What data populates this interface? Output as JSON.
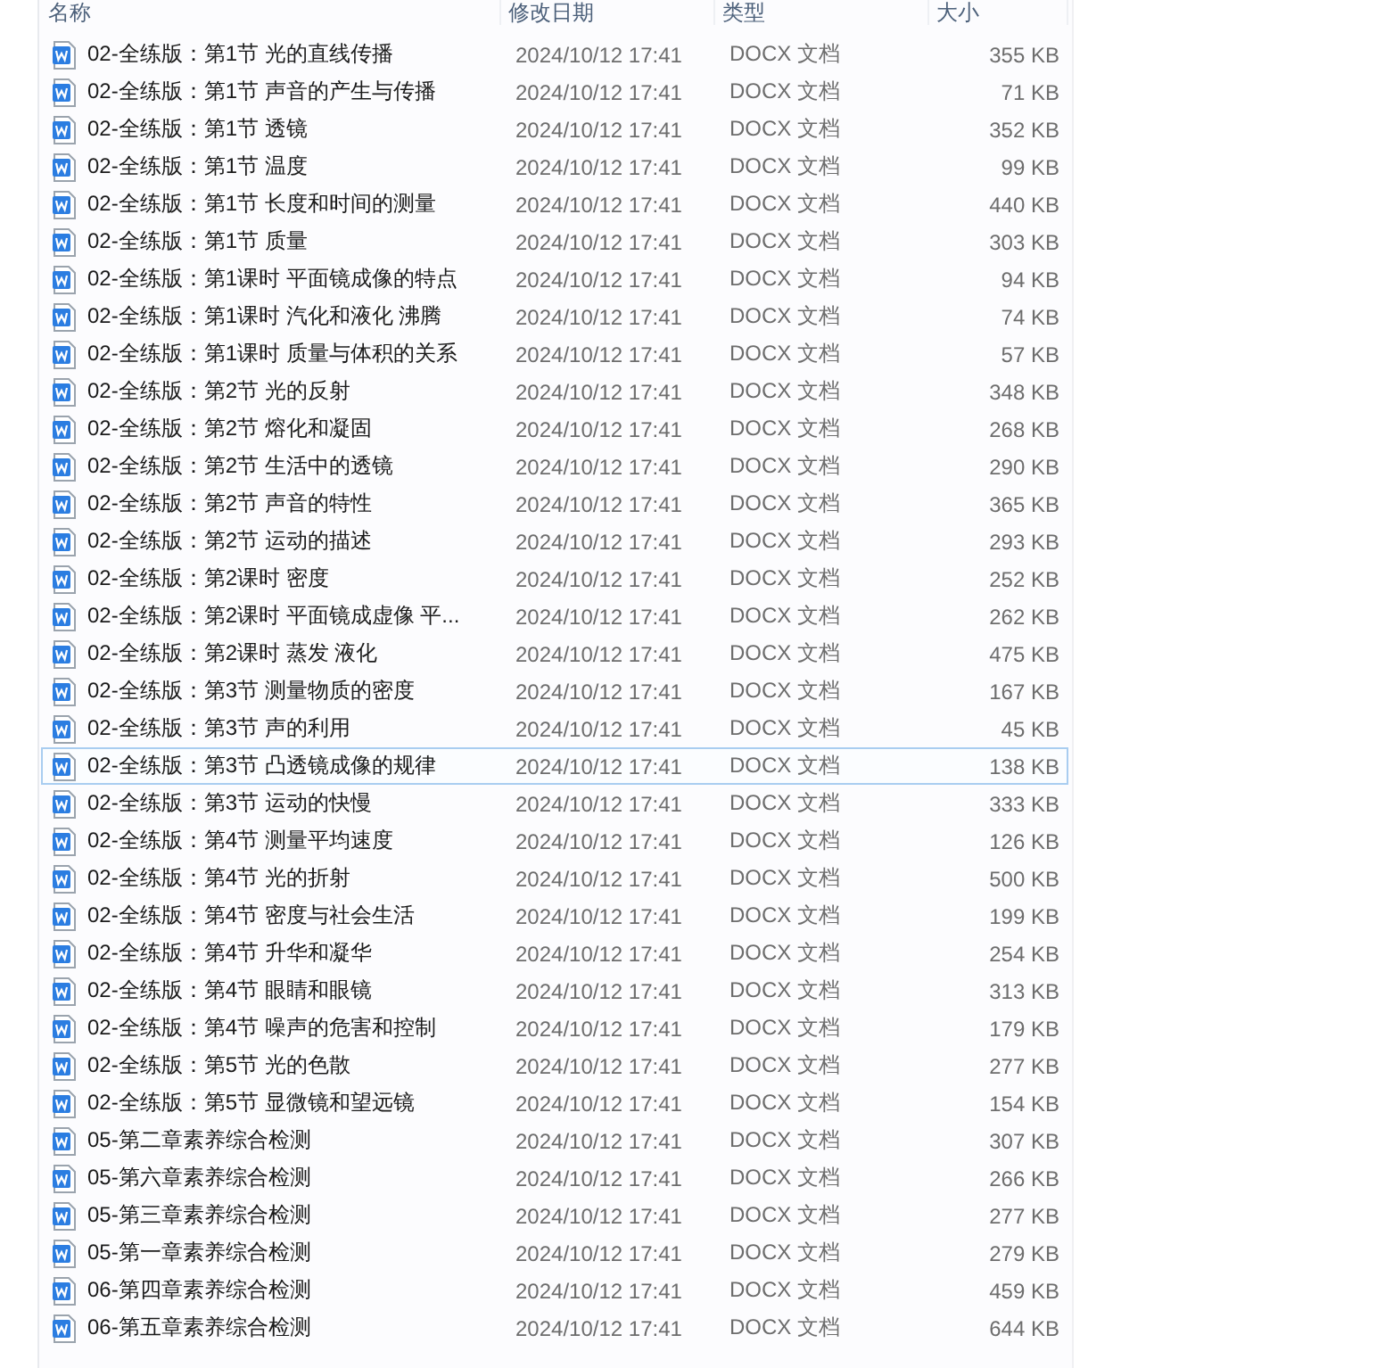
{
  "columns": [
    "名称",
    "修改日期",
    "类型",
    "大小"
  ],
  "files": [
    {
      "name": "02-全练版：第1节  光的直线传播",
      "modified": "2024/10/12 17:41",
      "type": "DOCX 文档",
      "size": "355 KB",
      "selected": false
    },
    {
      "name": "02-全练版：第1节  声音的产生与传播",
      "modified": "2024/10/12 17:41",
      "type": "DOCX 文档",
      "size": "71 KB",
      "selected": false
    },
    {
      "name": "02-全练版：第1节  透镜",
      "modified": "2024/10/12 17:41",
      "type": "DOCX 文档",
      "size": "352 KB",
      "selected": false
    },
    {
      "name": "02-全练版：第1节  温度",
      "modified": "2024/10/12 17:41",
      "type": "DOCX 文档",
      "size": "99 KB",
      "selected": false
    },
    {
      "name": "02-全练版：第1节  长度和时间的测量",
      "modified": "2024/10/12 17:41",
      "type": "DOCX 文档",
      "size": "440 KB",
      "selected": false
    },
    {
      "name": "02-全练版：第1节  质量",
      "modified": "2024/10/12 17:41",
      "type": "DOCX 文档",
      "size": "303 KB",
      "selected": false
    },
    {
      "name": "02-全练版：第1课时  平面镜成像的特点",
      "modified": "2024/10/12 17:41",
      "type": "DOCX 文档",
      "size": "94 KB",
      "selected": false
    },
    {
      "name": "02-全练版：第1课时  汽化和液化  沸腾",
      "modified": "2024/10/12 17:41",
      "type": "DOCX 文档",
      "size": "74 KB",
      "selected": false
    },
    {
      "name": "02-全练版：第1课时  质量与体积的关系",
      "modified": "2024/10/12 17:41",
      "type": "DOCX 文档",
      "size": "57 KB",
      "selected": false
    },
    {
      "name": "02-全练版：第2节  光的反射",
      "modified": "2024/10/12 17:41",
      "type": "DOCX 文档",
      "size": "348 KB",
      "selected": false
    },
    {
      "name": "02-全练版：第2节  熔化和凝固",
      "modified": "2024/10/12 17:41",
      "type": "DOCX 文档",
      "size": "268 KB",
      "selected": false
    },
    {
      "name": "02-全练版：第2节  生活中的透镜",
      "modified": "2024/10/12 17:41",
      "type": "DOCX 文档",
      "size": "290 KB",
      "selected": false
    },
    {
      "name": "02-全练版：第2节  声音的特性",
      "modified": "2024/10/12 17:41",
      "type": "DOCX 文档",
      "size": "365 KB",
      "selected": false
    },
    {
      "name": "02-全练版：第2节  运动的描述",
      "modified": "2024/10/12 17:41",
      "type": "DOCX 文档",
      "size": "293 KB",
      "selected": false
    },
    {
      "name": "02-全练版：第2课时  密度",
      "modified": "2024/10/12 17:41",
      "type": "DOCX 文档",
      "size": "252 KB",
      "selected": false
    },
    {
      "name": "02-全练版：第2课时  平面镜成虚像  平...",
      "modified": "2024/10/12 17:41",
      "type": "DOCX 文档",
      "size": "262 KB",
      "selected": false
    },
    {
      "name": "02-全练版：第2课时  蒸发  液化",
      "modified": "2024/10/12 17:41",
      "type": "DOCX 文档",
      "size": "475 KB",
      "selected": false
    },
    {
      "name": "02-全练版：第3节  测量物质的密度",
      "modified": "2024/10/12 17:41",
      "type": "DOCX 文档",
      "size": "167 KB",
      "selected": false
    },
    {
      "name": "02-全练版：第3节  声的利用",
      "modified": "2024/10/12 17:41",
      "type": "DOCX 文档",
      "size": "45 KB",
      "selected": false
    },
    {
      "name": "02-全练版：第3节  凸透镜成像的规律",
      "modified": "2024/10/12 17:41",
      "type": "DOCX 文档",
      "size": "138 KB",
      "selected": true
    },
    {
      "name": "02-全练版：第3节  运动的快慢",
      "modified": "2024/10/12 17:41",
      "type": "DOCX 文档",
      "size": "333 KB",
      "selected": false
    },
    {
      "name": "02-全练版：第4节  测量平均速度",
      "modified": "2024/10/12 17:41",
      "type": "DOCX 文档",
      "size": "126 KB",
      "selected": false
    },
    {
      "name": "02-全练版：第4节  光的折射",
      "modified": "2024/10/12 17:41",
      "type": "DOCX 文档",
      "size": "500 KB",
      "selected": false
    },
    {
      "name": "02-全练版：第4节  密度与社会生活",
      "modified": "2024/10/12 17:41",
      "type": "DOCX 文档",
      "size": "199 KB",
      "selected": false
    },
    {
      "name": "02-全练版：第4节  升华和凝华",
      "modified": "2024/10/12 17:41",
      "type": "DOCX 文档",
      "size": "254 KB",
      "selected": false
    },
    {
      "name": "02-全练版：第4节  眼睛和眼镜",
      "modified": "2024/10/12 17:41",
      "type": "DOCX 文档",
      "size": "313 KB",
      "selected": false
    },
    {
      "name": "02-全练版：第4节  噪声的危害和控制",
      "modified": "2024/10/12 17:41",
      "type": "DOCX 文档",
      "size": "179 KB",
      "selected": false
    },
    {
      "name": "02-全练版：第5节  光的色散",
      "modified": "2024/10/12 17:41",
      "type": "DOCX 文档",
      "size": "277 KB",
      "selected": false
    },
    {
      "name": "02-全练版：第5节  显微镜和望远镜",
      "modified": "2024/10/12 17:41",
      "type": "DOCX 文档",
      "size": "154 KB",
      "selected": false
    },
    {
      "name": "05-第二章素养综合检测",
      "modified": "2024/10/12 17:41",
      "type": "DOCX 文档",
      "size": "307 KB",
      "selected": false
    },
    {
      "name": "05-第六章素养综合检测",
      "modified": "2024/10/12 17:41",
      "type": "DOCX 文档",
      "size": "266 KB",
      "selected": false
    },
    {
      "name": "05-第三章素养综合检测",
      "modified": "2024/10/12 17:41",
      "type": "DOCX 文档",
      "size": "277 KB",
      "selected": false
    },
    {
      "name": "05-第一章素养综合检测",
      "modified": "2024/10/12 17:41",
      "type": "DOCX 文档",
      "size": "279 KB",
      "selected": false
    },
    {
      "name": "06-第四章素养综合检测",
      "modified": "2024/10/12 17:41",
      "type": "DOCX 文档",
      "size": "459 KB",
      "selected": false
    },
    {
      "name": "06-第五章素养综合检测",
      "modified": "2024/10/12 17:41",
      "type": "DOCX 文档",
      "size": "644 KB",
      "selected": false
    }
  ]
}
